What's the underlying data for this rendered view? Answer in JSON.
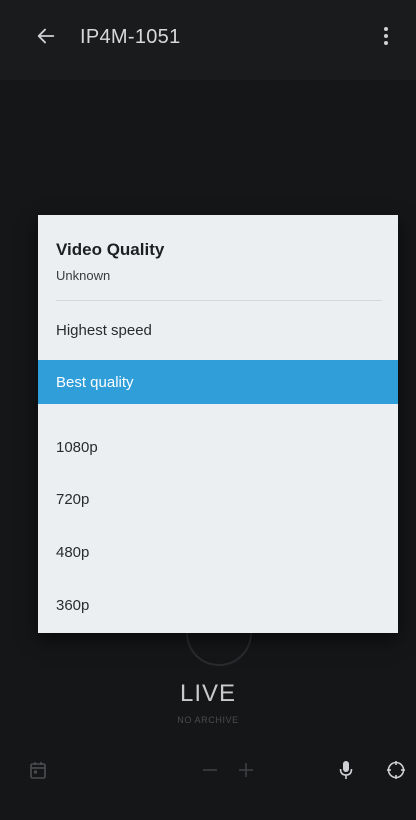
{
  "header": {
    "title": "IP4M-1051",
    "back_icon": "arrow-left-icon",
    "more_icon": "more-vertical-icon"
  },
  "player": {
    "live_label": "LIVE",
    "archive_label": "NO ARCHIVE"
  },
  "dialog": {
    "title": "Video Quality",
    "subtitle": "Unknown",
    "options": [
      {
        "label": "Highest speed",
        "selected": false
      },
      {
        "label": "Best quality",
        "selected": true
      },
      {
        "label": "1080p",
        "selected": false
      },
      {
        "label": "720p",
        "selected": false
      },
      {
        "label": "480p",
        "selected": false
      },
      {
        "label": "360p",
        "selected": false
      }
    ]
  },
  "toolbar": {
    "icons": [
      "calendar-icon",
      "zoom-out-icon",
      "zoom-in-icon",
      "microphone-icon",
      "ptz-control-icon"
    ]
  },
  "colors": {
    "accent": "#2f9ed9",
    "background": "#151618",
    "dialog_bg": "#eceff2"
  }
}
